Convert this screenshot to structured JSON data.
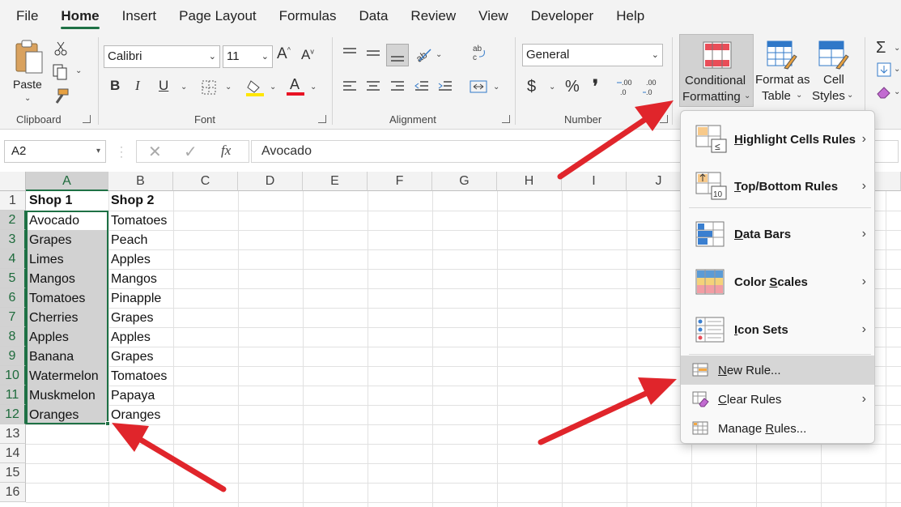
{
  "menu": {
    "tabs": [
      "File",
      "Home",
      "Insert",
      "Page Layout",
      "Formulas",
      "Data",
      "Review",
      "View",
      "Developer",
      "Help"
    ],
    "active": "Home"
  },
  "ribbon": {
    "clipboard": {
      "paste_label": "Paste",
      "group_label": "Clipboard"
    },
    "font": {
      "font_name": "Calibri",
      "font_size": "11",
      "group_label": "Font"
    },
    "alignment": {
      "group_label": "Alignment"
    },
    "number": {
      "format": "General",
      "group_label": "Number",
      "currency": "$",
      "percent": "%",
      "comma": "❜"
    },
    "styles": {
      "conditional_formatting_line1": "Conditional",
      "conditional_formatting_line2": "Formatting",
      "format_as_table_line1": "Format as",
      "format_as_table_line2": "Table",
      "cell_styles_line1": "Cell",
      "cell_styles_line2": "Styles"
    }
  },
  "formula_bar": {
    "name_box": "A2",
    "fx_label": "fx",
    "value": "Avocado"
  },
  "grid": {
    "columns": [
      "A",
      "B",
      "C",
      "D",
      "E",
      "F",
      "G",
      "H",
      "I",
      "J"
    ],
    "rows": [
      "1",
      "2",
      "3",
      "4",
      "5",
      "6",
      "7",
      "8",
      "9",
      "10",
      "11",
      "12",
      "13",
      "14",
      "15",
      "16"
    ],
    "col_a": [
      "Shop 1",
      "Avocado",
      "Grapes",
      "Limes",
      "Mangos",
      "Tomatoes",
      "Cherries",
      "Apples",
      "Banana",
      "Watermelon",
      "Muskmelon",
      "Oranges"
    ],
    "col_b": [
      "Shop 2",
      "Tomatoes",
      "Peach",
      "Apples",
      "Mangos",
      "Pinapple",
      "Grapes",
      "Apples",
      "Grapes",
      "Tomatoes",
      "Papaya",
      "Oranges"
    ]
  },
  "cf_menu": {
    "highlight_cells_rules": {
      "pre": "",
      "key": "H",
      "post": "ighlight Cells Rules"
    },
    "top_bottom_rules": {
      "pre": "",
      "key": "T",
      "post": "op/Bottom Rules"
    },
    "data_bars": {
      "pre": "",
      "key": "D",
      "post": "ata Bars"
    },
    "color_scales": {
      "pre": "Color ",
      "key": "S",
      "post": "cales"
    },
    "icon_sets": {
      "pre": "",
      "key": "I",
      "post": "con Sets"
    },
    "new_rule": {
      "pre": "",
      "key": "N",
      "post": "ew Rule..."
    },
    "clear_rules": {
      "pre": "",
      "key": "C",
      "post": "lear Rules"
    },
    "manage_rules": {
      "pre": "Manage ",
      "key": "R",
      "post": "ules..."
    }
  },
  "colors": {
    "accent_green": "#1e7145",
    "arrow_red": "#e0252b",
    "highlight_gray": "#d6d6d6"
  }
}
